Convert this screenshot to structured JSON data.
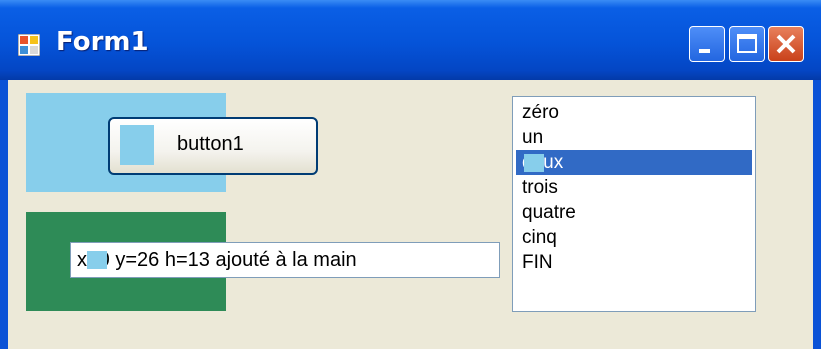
{
  "window": {
    "title": "Form1"
  },
  "colors": {
    "panel_blue": "#87ceeb",
    "panel_green": "#2e8b57",
    "selection": "#316ac5"
  },
  "button1": {
    "label": "button1"
  },
  "textbox": {
    "text": "x=0 y=26 h=13 ajouté à la main"
  },
  "listbox": {
    "items": [
      "zéro",
      "un",
      "deux",
      "trois",
      "quatre",
      "cinq",
      "FIN"
    ],
    "selected_index": 2
  }
}
